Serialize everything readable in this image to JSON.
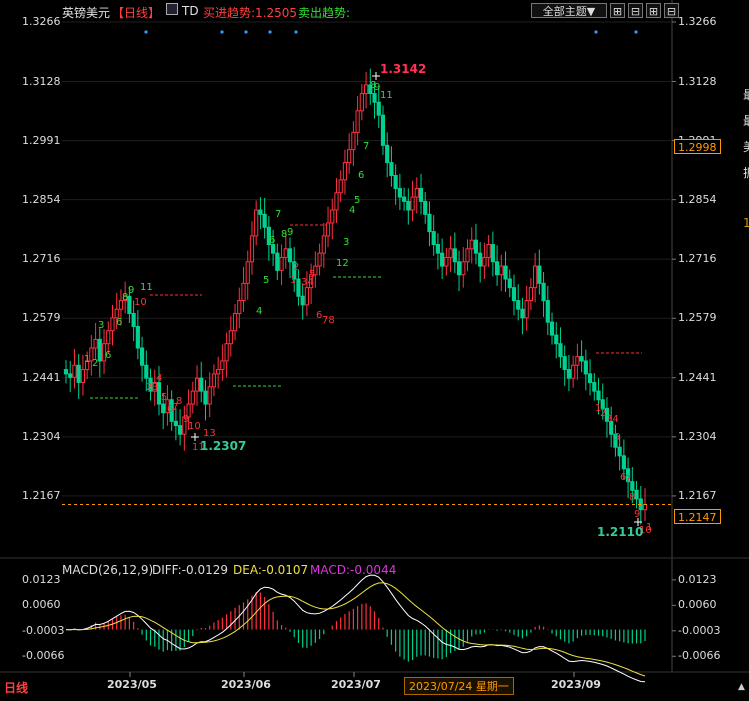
{
  "header": {
    "title": "英镑美元",
    "period": "【日线】",
    "indicator": "TD",
    "buy_trend": "买进趋势:1.2505",
    "sell_trend": "卖出趋势:",
    "theme_button": "全部主题▼",
    "tool_buttons": [
      "⊞",
      "⊟",
      "⊞",
      "⊟"
    ]
  },
  "main_axis": {
    "ticks": [
      "1.3266",
      "1.3128",
      "1.2991",
      "1.2854",
      "1.2716",
      "1.2579",
      "1.2441",
      "1.2304",
      "1.2167"
    ],
    "current_price_right": "1.2147",
    "marker_price_right": "1.2998"
  },
  "annotations": {
    "high": "1.3142",
    "low_may": "1.2307",
    "low_sep": "1.2110"
  },
  "macd": {
    "label": "MACD(26,12,9)",
    "diff": "DIFF:-0.0129",
    "dea": "DEA:-0.0107",
    "macd": "MACD:-0.0044",
    "ticks": [
      "0.0123",
      "0.0060",
      "-0.0003",
      "-0.0066"
    ]
  },
  "time_axis": {
    "labels": [
      "2023/05",
      "2023/06",
      "2023/07",
      "2023/09"
    ],
    "cursor_label": "2023/07/24 星期一"
  },
  "footer": {
    "period_tab": "日线",
    "pointer": "▲"
  },
  "right_cut_glyphs": [
    "最",
    "最",
    "美",
    "振",
    "1"
  ],
  "colors": {
    "up": "#ff3040",
    "down": "#00d090",
    "diff_line": "#ffffff",
    "dea_line": "#f0e040",
    "macd_bar_pos": "#ff3040",
    "macd_bar_neg": "#00d090",
    "td_setup_buy": "#ff3030",
    "td_setup_sell": "#55dd33"
  },
  "chart_data": {
    "type": "candlestick",
    "symbol": "GBP/USD",
    "y_range": [
      1.203,
      1.3266
    ],
    "x_labels": [
      "2023/05",
      "2023/06",
      "2023/07",
      "2023/09"
    ],
    "closes": [
      1.245,
      1.2442,
      1.247,
      1.243,
      1.246,
      1.248,
      1.251,
      1.253,
      1.248,
      1.252,
      1.255,
      1.258,
      1.26,
      1.262,
      1.263,
      1.259,
      1.256,
      1.251,
      1.247,
      1.244,
      1.241,
      1.243,
      1.238,
      1.236,
      1.239,
      1.234,
      1.233,
      1.231,
      1.235,
      1.238,
      1.241,
      1.244,
      1.241,
      1.238,
      1.242,
      1.245,
      1.246,
      1.248,
      1.252,
      1.255,
      1.259,
      1.262,
      1.266,
      1.271,
      1.277,
      1.283,
      1.282,
      1.279,
      1.275,
      1.273,
      1.269,
      1.272,
      1.274,
      1.271,
      1.267,
      1.263,
      1.261,
      1.265,
      1.268,
      1.27,
      1.273,
      1.277,
      1.28,
      1.283,
      1.287,
      1.29,
      1.294,
      1.297,
      1.301,
      1.306,
      1.31,
      1.312,
      1.31,
      1.308,
      1.305,
      1.298,
      1.294,
      1.291,
      1.288,
      1.286,
      1.285,
      1.283,
      1.286,
      1.288,
      1.285,
      1.282,
      1.278,
      1.275,
      1.273,
      1.27,
      1.272,
      1.274,
      1.271,
      1.268,
      1.271,
      1.274,
      1.276,
      1.273,
      1.27,
      1.272,
      1.275,
      1.271,
      1.268,
      1.27,
      1.267,
      1.265,
      1.262,
      1.26,
      1.258,
      1.262,
      1.265,
      1.27,
      1.266,
      1.262,
      1.257,
      1.254,
      1.252,
      1.249,
      1.246,
      1.244,
      1.247,
      1.249,
      1.248,
      1.245,
      1.243,
      1.241,
      1.239,
      1.237,
      1.234,
      1.231,
      1.228,
      1.226,
      1.223,
      1.22,
      1.218,
      1.216,
      1.2135,
      1.2147
    ],
    "macd": {
      "diff_last": -0.0129,
      "dea_last": -0.0107,
      "macd_last": -0.0044,
      "y_range": [
        -0.0095,
        0.0135
      ]
    }
  }
}
